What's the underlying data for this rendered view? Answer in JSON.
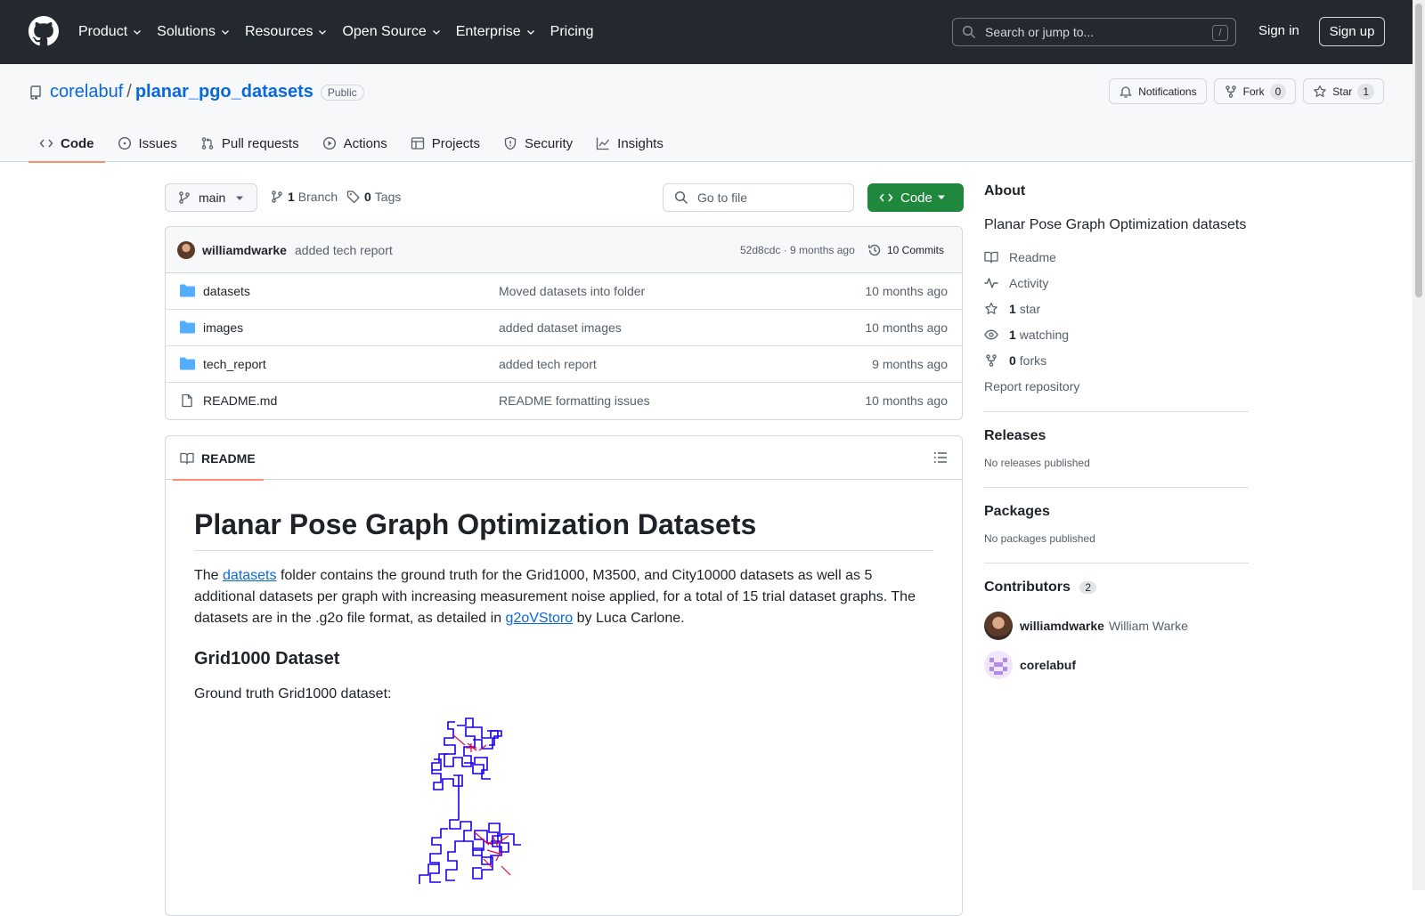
{
  "header": {
    "nav": [
      {
        "label": "Product",
        "has_menu": true
      },
      {
        "label": "Solutions",
        "has_menu": true
      },
      {
        "label": "Resources",
        "has_menu": true
      },
      {
        "label": "Open Source",
        "has_menu": true
      },
      {
        "label": "Enterprise",
        "has_menu": true
      },
      {
        "label": "Pricing",
        "has_menu": false
      }
    ],
    "search_placeholder": "Search or jump to...",
    "search_shortcut": "/",
    "sign_in": "Sign in",
    "sign_up": "Sign up"
  },
  "repo": {
    "owner": "corelabuf",
    "separator": "/",
    "name": "planar_pgo_datasets",
    "visibility": "Public",
    "notifications_label": "Notifications",
    "fork_label": "Fork",
    "fork_count": "0",
    "star_label": "Star",
    "star_count": "1"
  },
  "tabs": [
    {
      "label": "Code",
      "icon": "code-icon",
      "active": true
    },
    {
      "label": "Issues",
      "icon": "issue-icon"
    },
    {
      "label": "Pull requests",
      "icon": "pull-request-icon"
    },
    {
      "label": "Actions",
      "icon": "play-icon"
    },
    {
      "label": "Projects",
      "icon": "table-icon"
    },
    {
      "label": "Security",
      "icon": "shield-icon"
    },
    {
      "label": "Insights",
      "icon": "graph-icon"
    }
  ],
  "toolbar": {
    "branch": "main",
    "branch_count": "1",
    "branch_label": "Branch",
    "tag_count": "0",
    "tag_label": "Tags",
    "go_to_file": "Go to file",
    "code_button": "Code"
  },
  "latest_commit": {
    "author": "williamdwarke",
    "message": "added tech report",
    "sha_time": "52d8cdc · 9 months ago",
    "commits_label": "10 Commits"
  },
  "files": [
    {
      "type": "folder",
      "name": "datasets",
      "message": "Moved datasets into folder",
      "age": "10 months ago"
    },
    {
      "type": "folder",
      "name": "images",
      "message": "added dataset images",
      "age": "10 months ago"
    },
    {
      "type": "folder",
      "name": "tech_report",
      "message": "added tech report",
      "age": "9 months ago"
    },
    {
      "type": "file",
      "name": "README.md",
      "message": "README formatting issues",
      "age": "10 months ago"
    }
  ],
  "readme": {
    "tab_label": "README",
    "title": "Planar Pose Graph Optimization Datasets",
    "p1_before": "The ",
    "p1_link": "datasets",
    "p1_middle": " folder contains the ground truth for the Grid1000, M3500, and City10000 datasets as well as 5 additional datasets per graph with increasing measurement noise applied, for a total of 15 trial dataset graphs. The datasets are in the .g2o file format, as detailed in ",
    "p1_link2": "g2oVStoro",
    "p1_after": " by Luca Carlone.",
    "h2": "Grid1000 Dataset",
    "p2": "Ground truth Grid1000 dataset:"
  },
  "sidebar": {
    "about_title": "About",
    "description": "Planar Pose Graph Optimization datasets",
    "readme": "Readme",
    "activity": "Activity",
    "stars_count": "1",
    "stars_label": "star",
    "watching_count": "1",
    "watching_label": "watching",
    "forks_count": "0",
    "forks_label": "forks",
    "report": "Report repository",
    "releases_title": "Releases",
    "releases_empty": "No releases published",
    "packages_title": "Packages",
    "packages_empty": "No packages published",
    "contributors_title": "Contributors",
    "contributors_count": "2",
    "contributors": [
      {
        "login": "williamdwarke",
        "name": "William Warke"
      },
      {
        "login": "corelabuf",
        "name": ""
      }
    ]
  },
  "colors": {
    "header_bg": "#24292f",
    "link": "#0969da",
    "code_button": "#1f883d",
    "tab_underline": "#fd8c73",
    "folder": "#54aeff",
    "plot_edges": "#1a00e6",
    "plot_loops": "#e6004c"
  }
}
